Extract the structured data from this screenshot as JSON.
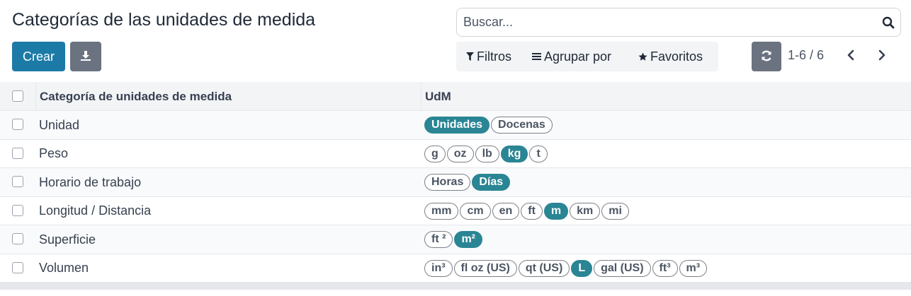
{
  "page": {
    "title": "Categorías de las unidades de medida",
    "create_label": "Crear",
    "download_icon": "download-icon"
  },
  "search": {
    "placeholder": "Buscar...",
    "icon": "search-icon"
  },
  "filters": {
    "filters_label": "Filtros",
    "group_label": "Agrupar por",
    "favorites_label": "Favoritos"
  },
  "pager": {
    "value": "1-6 / 6",
    "refresh_icon": "refresh-icon",
    "prev_icon": "chevron-left-icon",
    "next_icon": "chevron-right-icon"
  },
  "table": {
    "headers": {
      "category": "Categoría de unidades de medida",
      "uom": "UdM"
    },
    "rows": [
      {
        "name": "Unidad",
        "tags": [
          {
            "label": "Unidades",
            "selected": true
          },
          {
            "label": "Docenas",
            "selected": false
          }
        ]
      },
      {
        "name": "Peso",
        "tags": [
          {
            "label": "g",
            "selected": false
          },
          {
            "label": "oz",
            "selected": false
          },
          {
            "label": "lb",
            "selected": false
          },
          {
            "label": "kg",
            "selected": true
          },
          {
            "label": "t",
            "selected": false
          }
        ]
      },
      {
        "name": "Horario de trabajo",
        "tags": [
          {
            "label": "Horas",
            "selected": false
          },
          {
            "label": "Días",
            "selected": true
          }
        ]
      },
      {
        "name": "Longitud / Distancia",
        "tags": [
          {
            "label": "mm",
            "selected": false
          },
          {
            "label": "cm",
            "selected": false
          },
          {
            "label": "en",
            "selected": false
          },
          {
            "label": "ft",
            "selected": false
          },
          {
            "label": "m",
            "selected": true
          },
          {
            "label": "km",
            "selected": false
          },
          {
            "label": "mi",
            "selected": false
          }
        ]
      },
      {
        "name": "Superficie",
        "tags": [
          {
            "label": "ft ²",
            "selected": false
          },
          {
            "label": "m²",
            "selected": true
          }
        ]
      },
      {
        "name": "Volumen",
        "tags": [
          {
            "label": "in³",
            "selected": false
          },
          {
            "label": "fl oz (US)",
            "selected": false
          },
          {
            "label": "qt (US)",
            "selected": false
          },
          {
            "label": "L",
            "selected": true
          },
          {
            "label": "gal (US)",
            "selected": false
          },
          {
            "label": "ft³",
            "selected": false
          },
          {
            "label": "m³",
            "selected": false
          }
        ]
      }
    ]
  },
  "colors": {
    "primary": "#1c7aa7",
    "secondary": "#6b7280",
    "tag_selected": "#2a8594"
  }
}
